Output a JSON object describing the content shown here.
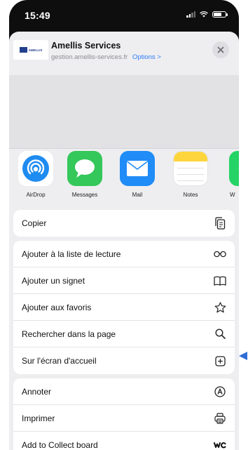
{
  "status_bar": {
    "time": "15:49"
  },
  "share_sheet": {
    "site": {
      "logo_text": "AMELLIS",
      "title": "Amellis Services",
      "url": "gestion.amellis-services.fr",
      "options_label": "Options >"
    },
    "apps": [
      {
        "label": "AirDrop",
        "icon": "airdrop-icon"
      },
      {
        "label": "Messages",
        "icon": "messages-icon"
      },
      {
        "label": "Mail",
        "icon": "mail-icon"
      },
      {
        "label": "Notes",
        "icon": "notes-icon"
      },
      {
        "label": "W",
        "icon": "whatsapp-icon"
      }
    ],
    "action_groups": [
      [
        {
          "label": "Copier",
          "icon": "copy-icon"
        }
      ],
      [
        {
          "label": "Ajouter à la liste de lecture",
          "icon": "glasses-icon"
        },
        {
          "label": "Ajouter un signet",
          "icon": "book-icon"
        },
        {
          "label": "Ajouter aux favoris",
          "icon": "star-icon"
        },
        {
          "label": "Rechercher dans la page",
          "icon": "search-icon"
        },
        {
          "label": "Sur l'écran d'accueil",
          "icon": "add-square-icon"
        }
      ],
      [
        {
          "label": "Annoter",
          "icon": "markup-icon"
        },
        {
          "label": "Imprimer",
          "icon": "printer-icon"
        },
        {
          "label": "Add to Collect board",
          "icon": "collect-icon"
        }
      ]
    ]
  },
  "colors": {
    "accent": "#2f7bf6",
    "sheet_background": "#eeeef0",
    "messages_green": "#34c759",
    "mail_blue": "#1f8cf7",
    "notes_yellow": "#ffd53d",
    "arrow_blue": "#2f6cd6"
  }
}
